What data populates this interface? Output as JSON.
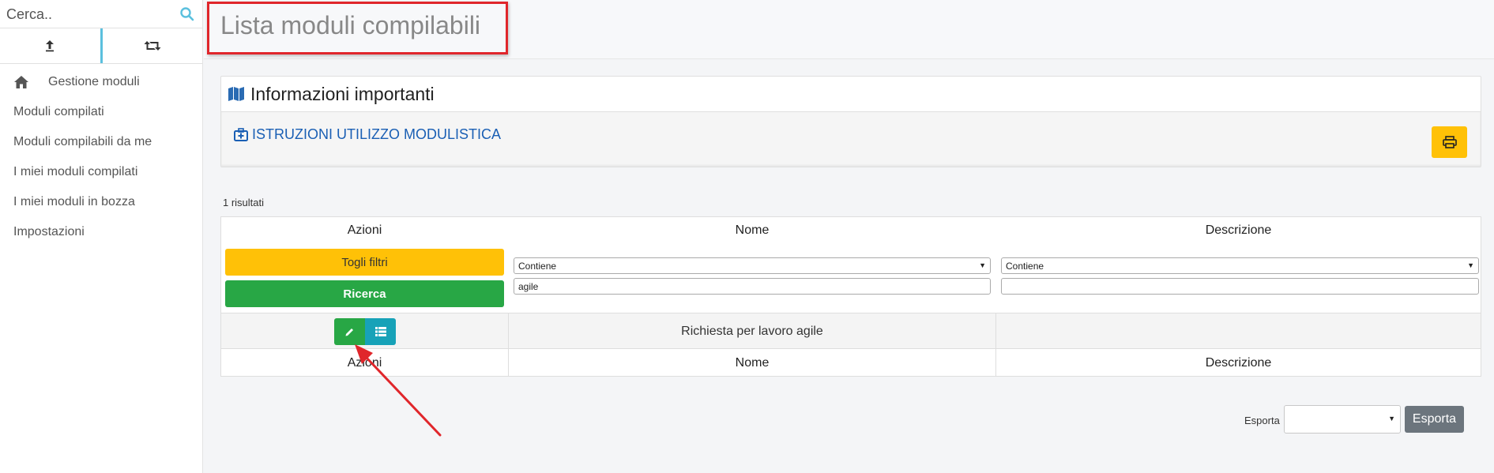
{
  "sidebar": {
    "search_placeholder": "Cerca..",
    "tabs": [
      {
        "icon": "upload-icon"
      },
      {
        "icon": "retweet-icon"
      }
    ],
    "items": [
      {
        "label": "Gestione moduli",
        "icon": "home-icon"
      },
      {
        "label": "Moduli compilati"
      },
      {
        "label": "Moduli compilabili da me"
      },
      {
        "label": "I miei moduli compilati"
      },
      {
        "label": "I miei moduli in bozza"
      },
      {
        "label": "Impostazioni"
      }
    ]
  },
  "page": {
    "title": "Lista moduli compilabili"
  },
  "info_panel": {
    "title": "Informazioni importanti",
    "icon": "map-icon",
    "link_label": "ISTRUZIONI UTILIZZO MODULISTICA",
    "link_icon": "medkit-icon",
    "print_icon": "print-icon"
  },
  "results": {
    "count_label": "1 risultati"
  },
  "table": {
    "headers": {
      "actions": "Azioni",
      "name": "Nome",
      "description": "Descrizione"
    },
    "clear_filters_label": "Togli filtri",
    "search_label": "Ricerca",
    "name_filter_operator": "Contiene",
    "name_filter_value": "agile",
    "description_filter_operator": "Contiene",
    "description_filter_value": "",
    "rows": [
      {
        "name": "Richiesta per lavoro agile",
        "description": ""
      }
    ]
  },
  "export": {
    "label": "Esporta",
    "selected": "",
    "button_label": "Esporta"
  },
  "colors": {
    "highlight": "#e0262b",
    "warning": "#ffc107",
    "success": "#28a745",
    "info": "#17a2b8",
    "link": "#1a5fb4",
    "secondary": "#6c757d"
  }
}
